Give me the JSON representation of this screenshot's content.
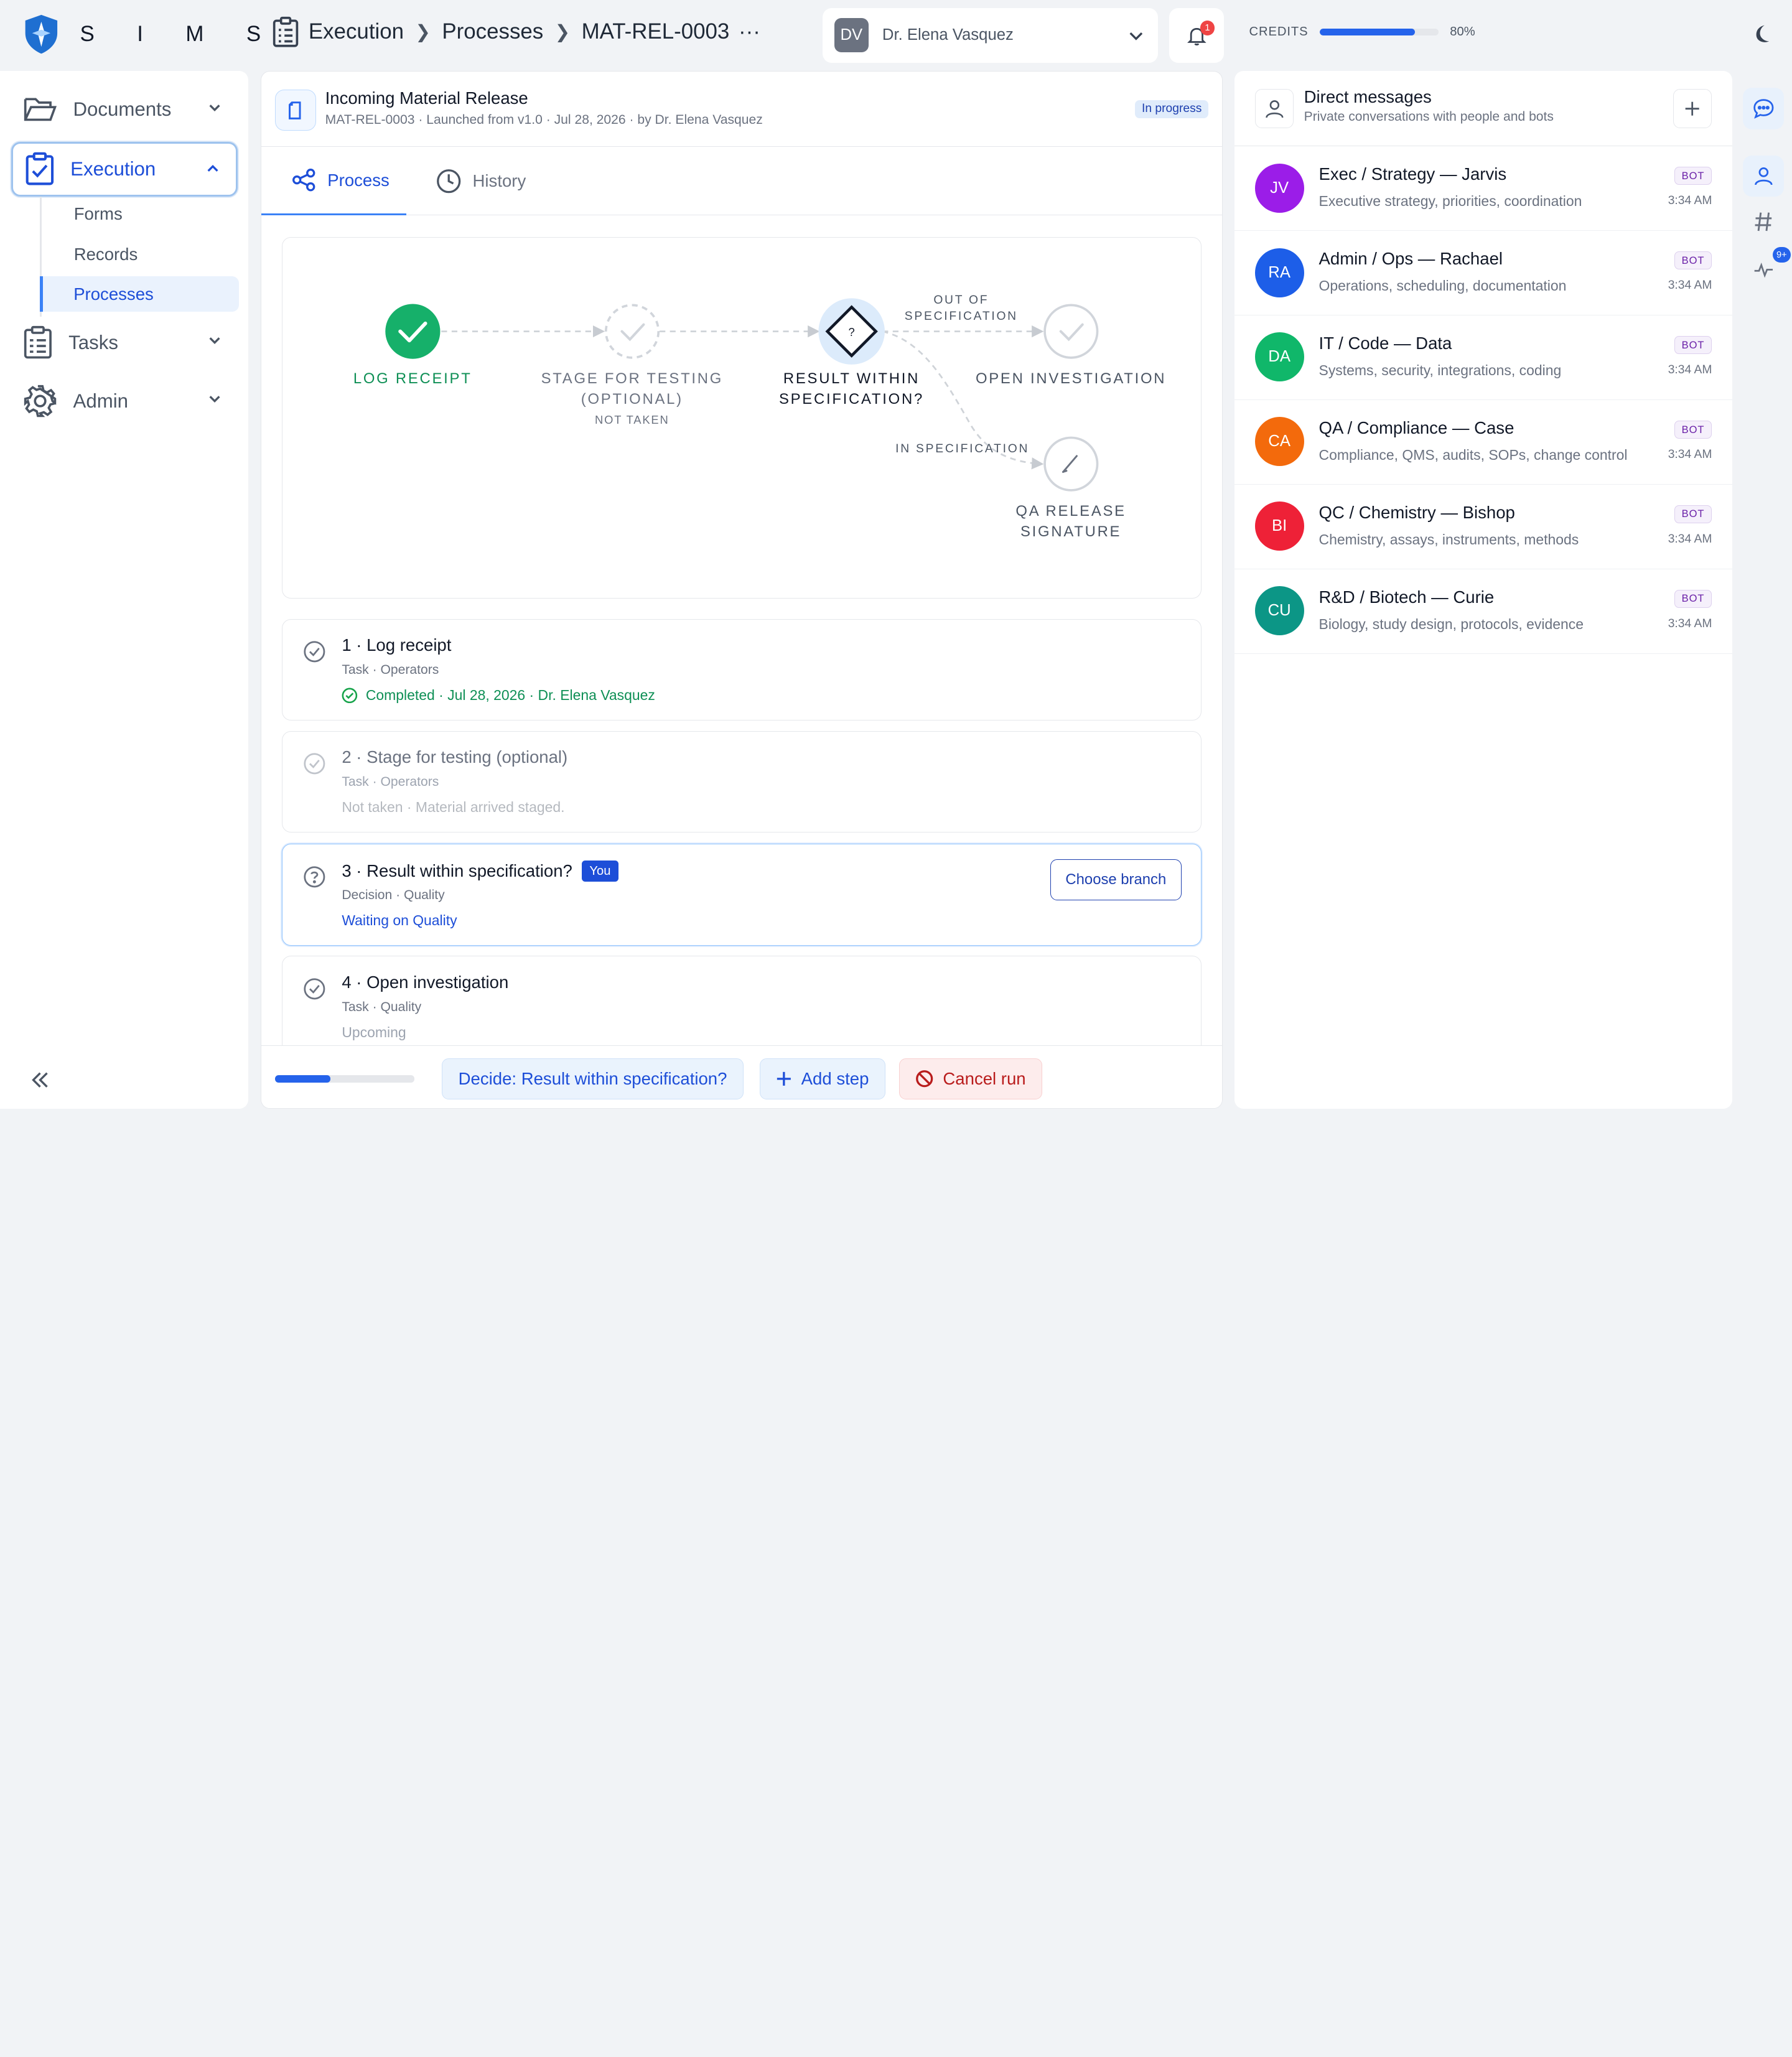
{
  "brand": {
    "name": "S I M S"
  },
  "breadcrumb": {
    "items": [
      "Execution",
      "Processes",
      "MAT-REL-0003"
    ],
    "more": "···"
  },
  "user": {
    "initials": "DV",
    "name": "Dr. Elena Vasquez"
  },
  "notifications": {
    "count": "1"
  },
  "credits": {
    "label": "CREDITS",
    "percent": 80,
    "percent_text": "80%"
  },
  "sidebar": {
    "documents": "Documents",
    "execution": "Execution",
    "sub": [
      "Forms",
      "Records",
      "Processes"
    ],
    "tasks": "Tasks",
    "admin": "Admin"
  },
  "process": {
    "title": "Incoming Material Release",
    "subtitle": "MAT-REL-0003 · Launched from v1.0 · Jul 28, 2026 · by Dr. Elena Vasquez",
    "status": "In progress"
  },
  "tabs": {
    "process": "Process",
    "history": "History"
  },
  "flow": {
    "nodes": {
      "log_receipt": "LOG RECEIPT",
      "stage_line1": "STAGE FOR TESTING",
      "stage_line2": "(OPTIONAL)",
      "stage_sub": "NOT TAKEN",
      "decision_line1": "RESULT WITHIN",
      "decision_line2": "SPECIFICATION?",
      "decision_glyph": "?",
      "open_inv": "OPEN INVESTIGATION",
      "qa_line1": "QA RELEASE",
      "qa_line2": "SIGNATURE"
    },
    "edges": {
      "oos_line1": "OUT OF",
      "oos_line2": "SPECIFICATION",
      "in_spec": "IN SPECIFICATION"
    }
  },
  "steps": [
    {
      "title": "1 · Log receipt",
      "meta": "Task · Operators",
      "status": "Completed · Jul 28, 2026 · Dr. Elena Vasquez"
    },
    {
      "title": "2 · Stage for testing (optional)",
      "meta": "Task · Operators",
      "status": "Not taken · Material arrived staged."
    },
    {
      "title": "3 · Result within specification?",
      "badge": "You",
      "meta": "Decision · Quality",
      "status": "Waiting on Quality",
      "action": "Choose branch"
    },
    {
      "title": "4 · Open investigation",
      "meta": "Task · Quality",
      "status": "Upcoming"
    }
  ],
  "bottom": {
    "progress": 40,
    "decide": "Decide: Result within specification?",
    "add_step": "Add step",
    "cancel": "Cancel run"
  },
  "dm": {
    "title": "Direct messages",
    "subtitle": "Private conversations with people and bots",
    "items": [
      {
        "initials": "JV",
        "color": "#9b1de8",
        "name": "Exec / Strategy — Jarvis",
        "desc": "Executive strategy, priorities, coordination",
        "badge": "BOT",
        "time": "3:34 AM"
      },
      {
        "initials": "RA",
        "color": "#1d5ee8",
        "name": "Admin / Ops — Rachael",
        "desc": "Operations, scheduling, documentation",
        "badge": "BOT",
        "time": "3:34 AM"
      },
      {
        "initials": "DA",
        "color": "#10b76a",
        "name": "IT / Code — Data",
        "desc": "Systems, security, integrations, coding",
        "badge": "BOT",
        "time": "3:34 AM"
      },
      {
        "initials": "CA",
        "color": "#f36a0c",
        "name": "QA / Compliance — Case",
        "desc": "Compliance, QMS, audits, SOPs, change control",
        "badge": "BOT",
        "time": "3:34 AM"
      },
      {
        "initials": "BI",
        "color": "#ee2137",
        "name": "QC / Chemistry — Bishop",
        "desc": "Chemistry, assays, instruments, methods",
        "badge": "BOT",
        "time": "3:34 AM"
      },
      {
        "initials": "CU",
        "color": "#0c9686",
        "name": "R&D / Biotech — Curie",
        "desc": "Biology, study design, protocols, evidence",
        "badge": "BOT",
        "time": "3:34 AM"
      }
    ]
  },
  "rail": {
    "activity_badge": "9+"
  }
}
